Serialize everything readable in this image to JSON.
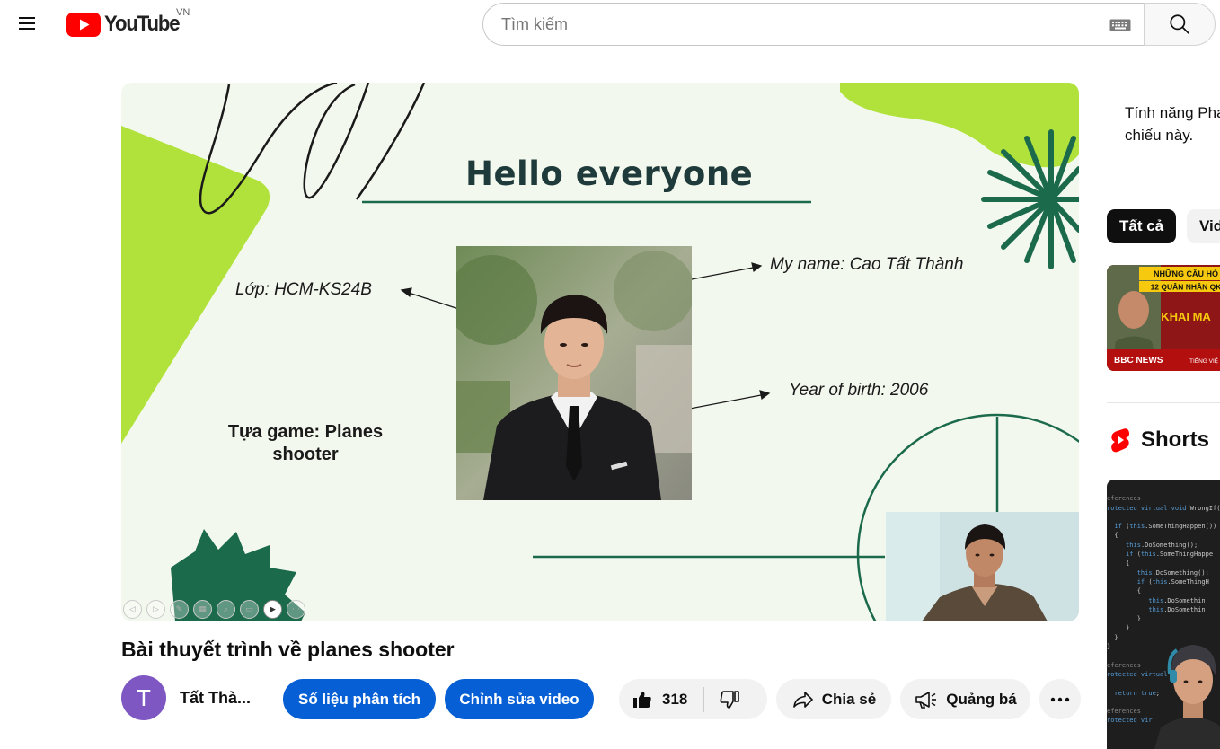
{
  "header": {
    "logo_text": "YouTube",
    "country_code": "VN",
    "search_placeholder": "Tìm kiếm"
  },
  "player": {
    "slide": {
      "title": "Hello everyone",
      "class_label": "Lớp: HCM-KS24B",
      "name_label": "My name: Cao Tất Thành",
      "birth_label": "Year of birth: 2006",
      "game_label": "Tựa game: Planes shooter"
    }
  },
  "video": {
    "title": "Bài thuyết trình về planes shooter",
    "channel_initial": "T",
    "channel_name": "Tất Thà...",
    "analytics_button": "Số liệu phân tích",
    "edit_button": "Chỉnh sửa video",
    "like_count": "318",
    "share_button": "Chia sẻ",
    "promote_button": "Quảng bá"
  },
  "sidebar": {
    "notice_line1": "Tính năng Pha",
    "notice_line2": "chiếu này.",
    "chips": [
      "Tất cả",
      "Vid"
    ],
    "thumb_banner_top": "NHỮNG CÂU HỎ",
    "thumb_banner_sub": "12 QUÂN NHÂN QK",
    "thumb_headline": "KHAI MẠ",
    "thumb_brand": "BBC NEWS",
    "thumb_brand_sub": "TIẾNG VIỆ",
    "shorts_label": "Shorts"
  },
  "colors": {
    "youtube_red": "#ff0000",
    "blue_button": "#065fd4",
    "slide_green": "#1c6a4c",
    "slide_lime": "#b1e23c",
    "slide_bg": "#f3f8ee"
  }
}
